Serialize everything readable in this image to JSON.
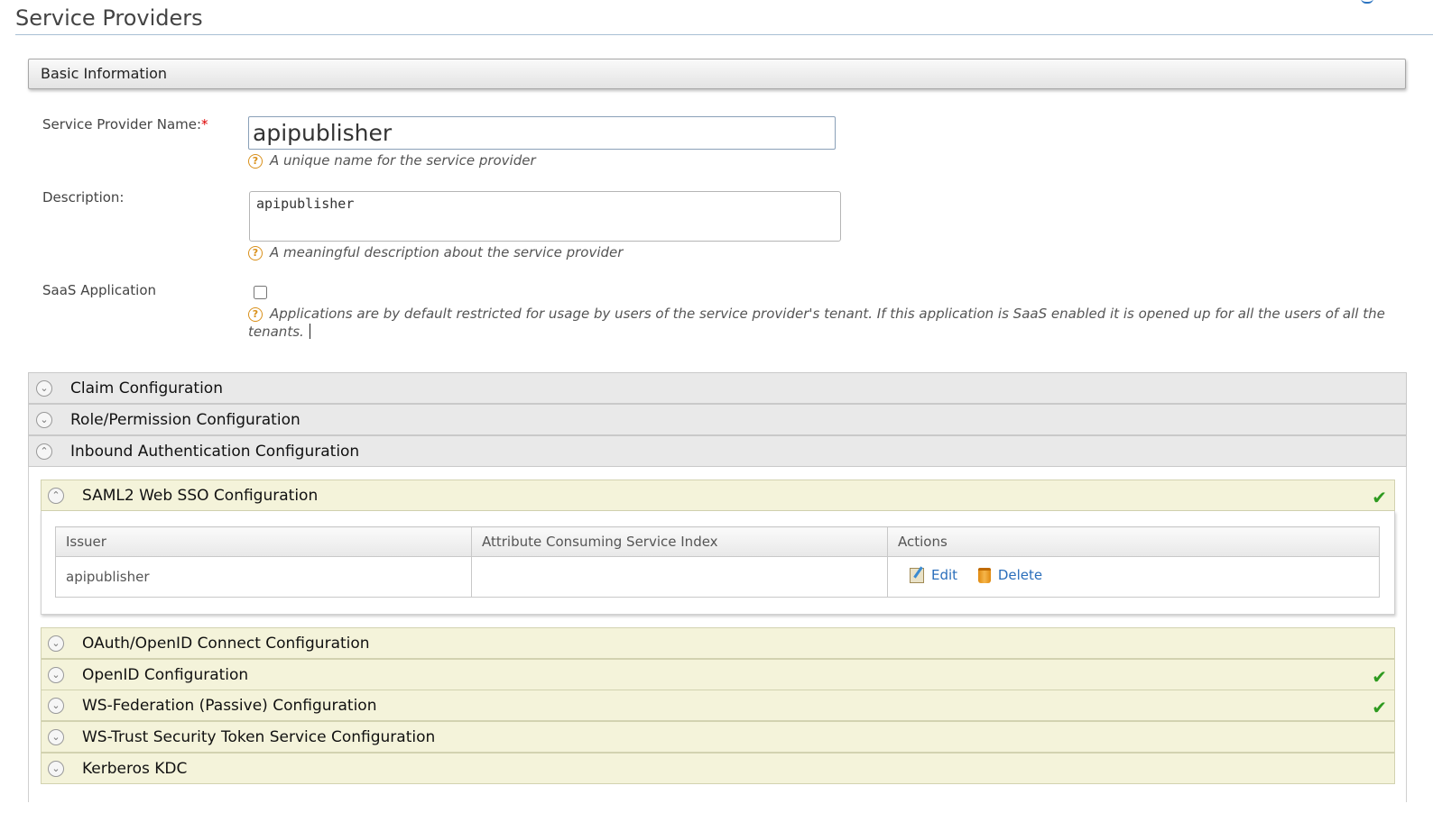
{
  "page": {
    "title": "Service Providers"
  },
  "basic_info": {
    "header": "Basic Information",
    "name_label": "Service Provider Name:",
    "required_mark": "*",
    "name_value": "apipublisher",
    "name_help": "A unique name for the service provider",
    "description_label": "Description:",
    "description_value": "apipublisher",
    "description_help": "A meaningful description about the service provider",
    "saas_label": "SaaS Application",
    "saas_checked": false,
    "saas_help": "Applications are by default restricted for usage by users of the service provider's tenant. If this application is SaaS enabled it is opened up for all the users of all the tenants.",
    "help_icon_glyph": "?"
  },
  "sections": {
    "claim": "Claim Configuration",
    "role": "Role/Permission Configuration",
    "inbound": "Inbound Authentication Configuration"
  },
  "inbound": {
    "saml": {
      "title": "SAML2 Web SSO Configuration",
      "configured": true,
      "columns": [
        "Issuer",
        "Attribute Consuming Service Index",
        "Actions"
      ],
      "rows": [
        {
          "issuer": "apipublisher",
          "index": "",
          "edit_label": "Edit",
          "delete_label": "Delete"
        }
      ]
    },
    "oauth": {
      "title": "OAuth/OpenID Connect Configuration",
      "configured": false
    },
    "openid": {
      "title": "OpenID Configuration",
      "configured": true
    },
    "wsfed": {
      "title": "WS-Federation (Passive) Configuration",
      "configured": true
    },
    "wstrust": {
      "title": "WS-Trust Security Token Service Configuration",
      "configured": false
    },
    "kerberos": {
      "title": "Kerberos KDC",
      "configured": false
    }
  },
  "glyphs": {
    "expand": "⌄",
    "collapse": "⌃",
    "check": "✔"
  },
  "colors": {
    "link": "#2a6ebb",
    "check": "#2e9a1f",
    "inner_panel": "#f4f3da",
    "outer_panel": "#e9e9e9",
    "help_icon": "#d9901b"
  }
}
